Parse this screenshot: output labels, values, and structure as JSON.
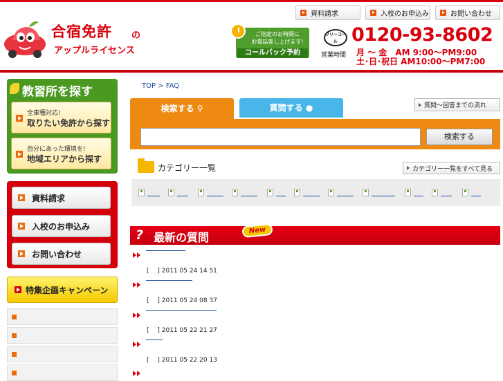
{
  "site": {
    "logo_main": "合宿免許",
    "logo_no": "の",
    "logo_sub": "アップルライセンス"
  },
  "top_nav": {
    "items": [
      {
        "label": "資料請求"
      },
      {
        "label": "入校のお申込み"
      },
      {
        "label": "お問い合わせ"
      }
    ]
  },
  "callback": {
    "line1": "ご指定のお時間に",
    "line2": "お電話差し上げます!",
    "button": "コールバック予約"
  },
  "contact": {
    "free_label": "フリーコール",
    "phone": "0120-93-8602",
    "hours_label": "営業時間",
    "hours_weekday": "月 ～ 金　AM 9:00～PM9:00",
    "hours_weekend": "土･日･祝日 AM10:00～PM7:00"
  },
  "sidebar": {
    "find_title": "教習所を探す",
    "find_cards": [
      {
        "sub": "全車種対応!",
        "main": "取りたい免許から探す"
      },
      {
        "sub": "自分にあった環境を!",
        "main": "地域エリアから探す"
      }
    ],
    "action_buttons": [
      {
        "label": "資料請求"
      },
      {
        "label": "入校のお申込み"
      },
      {
        "label": "お問い合わせ"
      }
    ],
    "campaign": "特集企画キャンペーン"
  },
  "main": {
    "breadcrumb": "TOP > FAQ",
    "tab_search": "検索する",
    "tab_ask": "質問する",
    "flow_link": "質問～回答までの流れ",
    "search_button": "検索する",
    "search_value": "",
    "category_title": "カテゴリー一覧",
    "all_categories": "カテゴリー一覧をすべて見る",
    "new_title": "最新の質問",
    "new_badge": "New",
    "questions": [
      {
        "meta": "[　  ] 2011 05 24  14  51"
      },
      {
        "meta": "[　  ] 2011 05 24  08  37"
      },
      {
        "meta": "[　  ] 2011 05 22  21  27"
      },
      {
        "meta": "[　  ] 2011 05 22  20  13"
      }
    ]
  },
  "colors": {
    "brand_red": "#d9000d",
    "search_orange": "#ee8a12",
    "ask_blue": "#49b6e9",
    "find_green": "#4a9a21"
  }
}
